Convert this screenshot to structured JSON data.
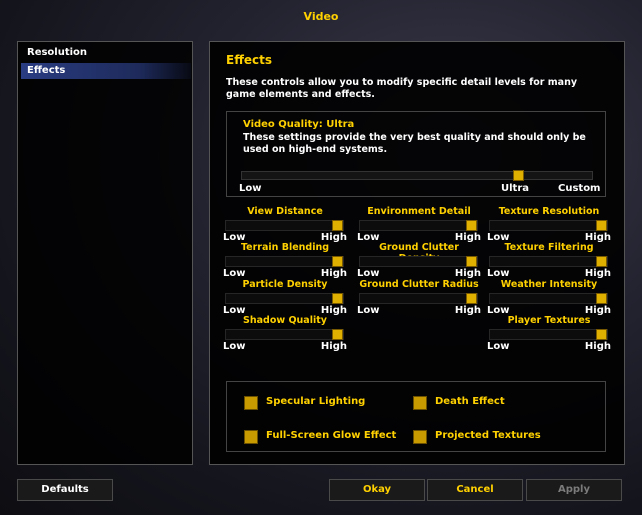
{
  "window": {
    "title": "Video"
  },
  "categories": [
    {
      "label": "Resolution",
      "selected": false
    },
    {
      "label": "Effects",
      "selected": true
    }
  ],
  "panel": {
    "title": "Effects",
    "description": "These controls allow you to modify specific detail levels for many game elements and effects."
  },
  "quality": {
    "title": "Video Quality: Ultra",
    "description": "These settings provide the very best quality and should only be used on high-end systems.",
    "low_label": "Low",
    "ultra_label": "Ultra",
    "custom_label": "Custom",
    "level_fraction": 0.8
  },
  "sliders": [
    {
      "label": "View Distance",
      "low": "Low",
      "high": "High",
      "value": 1.0
    },
    {
      "label": "Environment Detail",
      "low": "Low",
      "high": "High",
      "value": 1.0
    },
    {
      "label": "Texture Resolution",
      "low": "Low",
      "high": "High",
      "value": 1.0
    },
    {
      "label": "Terrain Blending",
      "low": "Low",
      "high": "High",
      "value": 1.0
    },
    {
      "label": "Ground Clutter Density",
      "low": "Low",
      "high": "High",
      "value": 1.0
    },
    {
      "label": "Texture Filtering",
      "low": "Low",
      "high": "High",
      "value": 1.0
    },
    {
      "label": "Particle Density",
      "low": "Low",
      "high": "High",
      "value": 1.0
    },
    {
      "label": "Ground Clutter Radius",
      "low": "Low",
      "high": "High",
      "value": 1.0
    },
    {
      "label": "Weather Intensity",
      "low": "Low",
      "high": "High",
      "value": 1.0
    },
    {
      "label": "Shadow Quality",
      "low": "Low",
      "high": "High",
      "value": 1.0
    },
    {
      "label": "Player Textures",
      "low": "Low",
      "high": "High",
      "value": 1.0
    }
  ],
  "checkboxes": [
    {
      "label": "Specular Lighting",
      "checked": true
    },
    {
      "label": "Death Effect",
      "checked": true
    },
    {
      "label": "Full-Screen Glow Effect",
      "checked": true
    },
    {
      "label": "Projected Textures",
      "checked": true
    }
  ],
  "buttons": {
    "defaults": "Defaults",
    "okay": "Okay",
    "cancel": "Cancel",
    "apply": "Apply"
  },
  "colors": {
    "label_gold": "#ffd100",
    "thumb_gold": "#e0b000",
    "selected_blue": "#2a3c82",
    "disabled_gray": "#7b7b7b"
  }
}
